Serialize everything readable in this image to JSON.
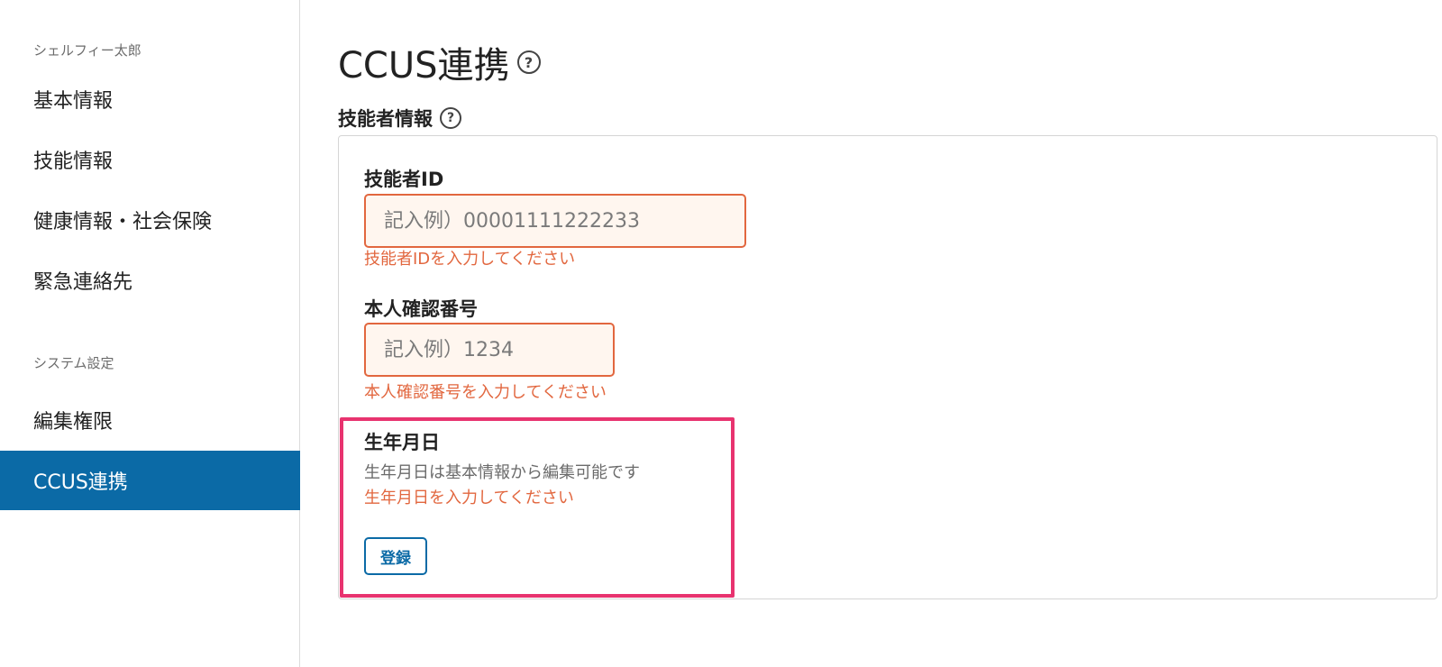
{
  "sidebar": {
    "user_label": "シェルフィー太郎",
    "profile_items": [
      "基本情報",
      "技能情報",
      "健康情報・社会保険",
      "緊急連絡先"
    ],
    "system_label": "システム設定",
    "system_items": [
      "編集権限",
      "CCUS連携"
    ],
    "active_item": "CCUS連携"
  },
  "main": {
    "title": "CCUS連携",
    "help_glyph": "?",
    "section_title": "技能者情報",
    "form": {
      "worker_id": {
        "label": "技能者ID",
        "placeholder": "記入例）00001111222233",
        "value": "",
        "error": "技能者IDを入力してください"
      },
      "identity_number": {
        "label": "本人確認番号",
        "placeholder": "記入例）1234",
        "value": "",
        "error": "本人確認番号を入力してください"
      },
      "birthdate": {
        "label": "生年月日",
        "help": "生年月日は基本情報から編集可能です",
        "error": "生年月日を入力してください"
      },
      "submit_label": "登録"
    }
  },
  "colors": {
    "accent": "#0b6aa6",
    "error": "#e2673f",
    "error_field_bg": "#fff6ef",
    "highlight": "#e8336f"
  }
}
